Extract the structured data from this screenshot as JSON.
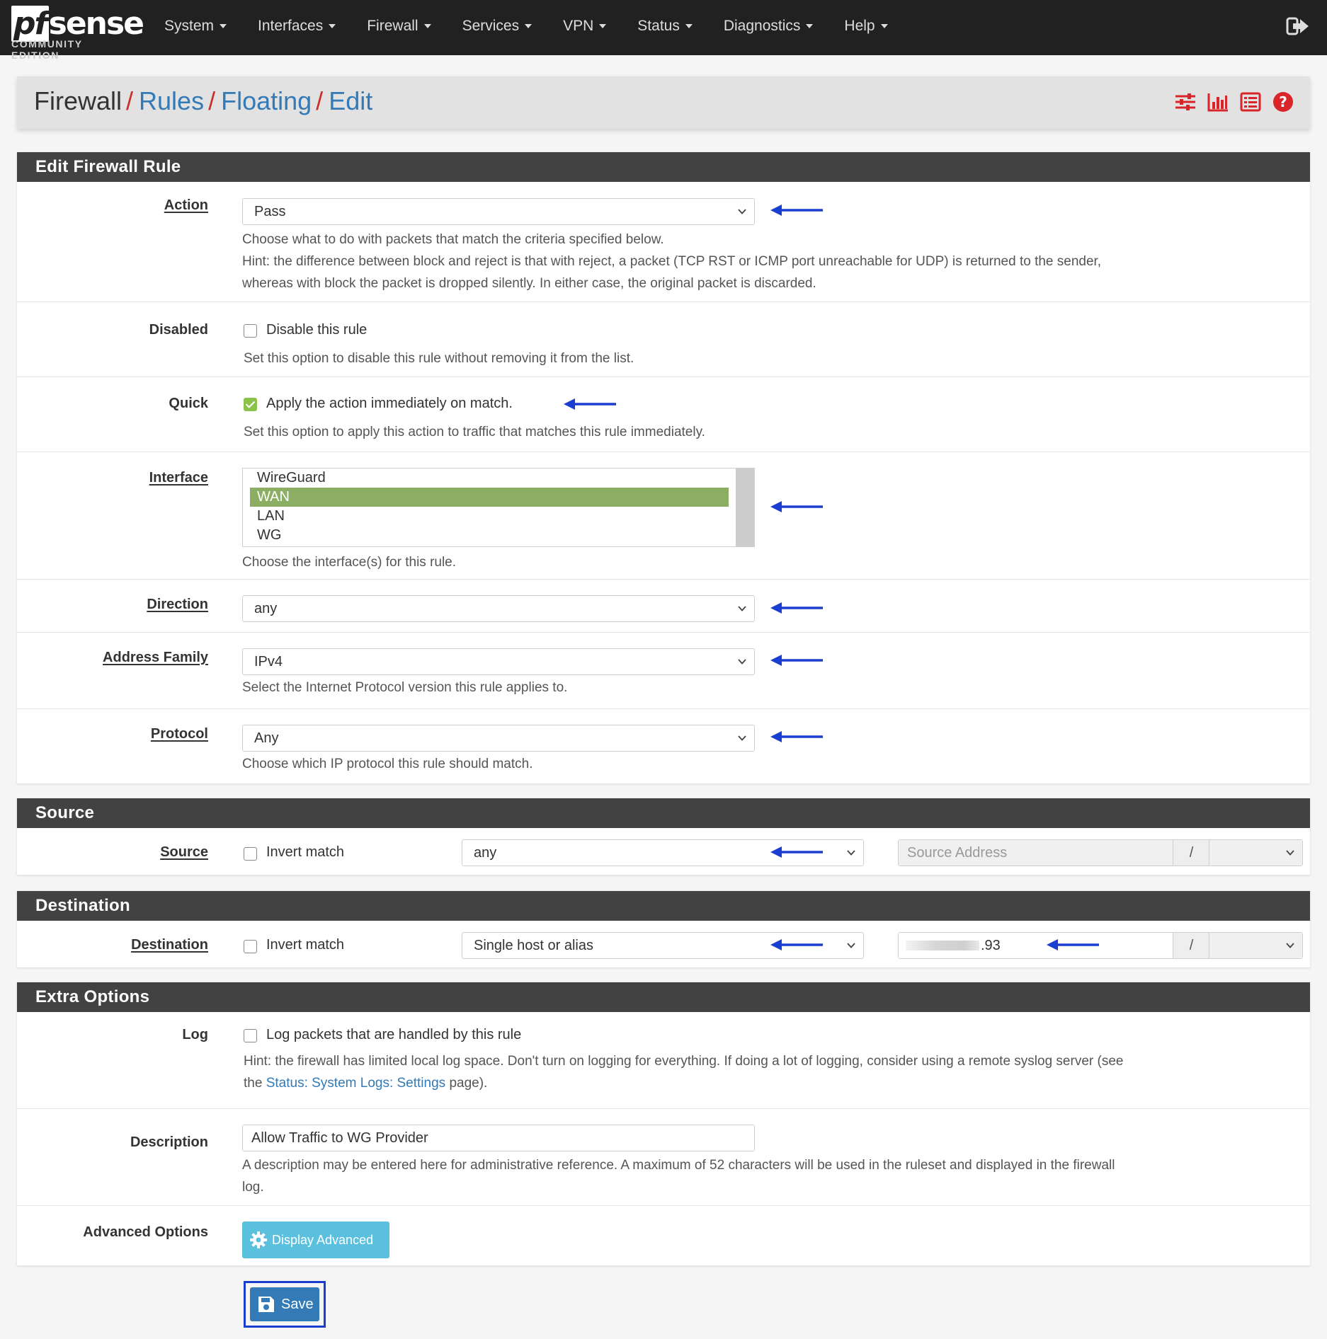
{
  "brand": {
    "logo_prefix": "pf",
    "logo_suffix": "sense",
    "edition": "COMMUNITY EDITION"
  },
  "nav": {
    "items": [
      "System",
      "Interfaces",
      "Firewall",
      "Services",
      "VPN",
      "Status",
      "Diagnostics",
      "Help"
    ],
    "logout_icon": "sign-out-icon"
  },
  "breadcrumb": {
    "root": "Firewall",
    "sep": "/",
    "rules": "Rules",
    "floating": "Floating",
    "edit": "Edit",
    "icons": [
      "sliders-icon",
      "bar-chart-icon",
      "list-icon",
      "help-circle-icon"
    ]
  },
  "colors": {
    "nav_bg": "#212121",
    "panel_heading": "#424242",
    "link": "#337ab7",
    "crumb_sep": "#c9302c",
    "arrow": "#1a3fd0",
    "selected_option": "#8bae62",
    "check_green": "#8bc34a",
    "info_button": "#5bc0de",
    "primary_button": "#337ab7",
    "icon_red": "#d9252a"
  },
  "edit_rule": {
    "heading": "Edit Firewall Rule",
    "action": {
      "label": "Action",
      "value": "Pass",
      "help1": "Choose what to do with packets that match the criteria specified below.",
      "help2": "Hint: the difference between block and reject is that with reject, a packet (TCP RST or ICMP port unreachable for UDP) is returned to the sender,",
      "help3": "whereas with block the packet is dropped silently. In either case, the original packet is discarded."
    },
    "disabled": {
      "label": "Disabled",
      "checkbox": "Disable this rule",
      "checked": false,
      "help": "Set this option to disable this rule without removing it from the list."
    },
    "quick": {
      "label": "Quick",
      "checkbox": "Apply the action immediately on match.",
      "checked": true,
      "help": "Set this option to apply this action to traffic that matches this rule immediately."
    },
    "interface": {
      "label": "Interface",
      "options": [
        "WireGuard",
        "WAN",
        "LAN",
        "WG"
      ],
      "selected": "WAN",
      "help": "Choose the interface(s) for this rule."
    },
    "direction": {
      "label": "Direction",
      "value": "any"
    },
    "address_family": {
      "label": "Address Family",
      "value": "IPv4",
      "help": "Select the Internet Protocol version this rule applies to."
    },
    "protocol": {
      "label": "Protocol",
      "value": "Any",
      "help": "Choose which IP protocol this rule should match."
    }
  },
  "source": {
    "heading": "Source",
    "label": "Source",
    "invert": "Invert match",
    "invert_checked": false,
    "type": "any",
    "address_placeholder": "Source Address",
    "slash": "/"
  },
  "destination": {
    "heading": "Destination",
    "label": "Destination",
    "invert": "Invert match",
    "invert_checked": false,
    "type": "Single host or alias",
    "address_suffix": ".93",
    "slash": "/"
  },
  "extra": {
    "heading": "Extra Options",
    "log": {
      "label": "Log",
      "checkbox": "Log packets that are handled by this rule",
      "checked": false,
      "hint_a": "Hint: the firewall has limited local log space. Don't turn on logging for everything. If doing a lot of logging, consider using a remote syslog server (see",
      "hint_b_pre": "the ",
      "hint_link": "Status: System Logs: Settings",
      "hint_b_post": " page)."
    },
    "description": {
      "label": "Description",
      "value": "Allow Traffic to WG Provider",
      "help1": "A description may be entered here for administrative reference. A maximum of 52 characters will be used in the ruleset and displayed in the firewall",
      "help2": "log."
    },
    "advanced": {
      "label": "Advanced Options",
      "button": "Display Advanced"
    }
  },
  "save_button": "Save"
}
